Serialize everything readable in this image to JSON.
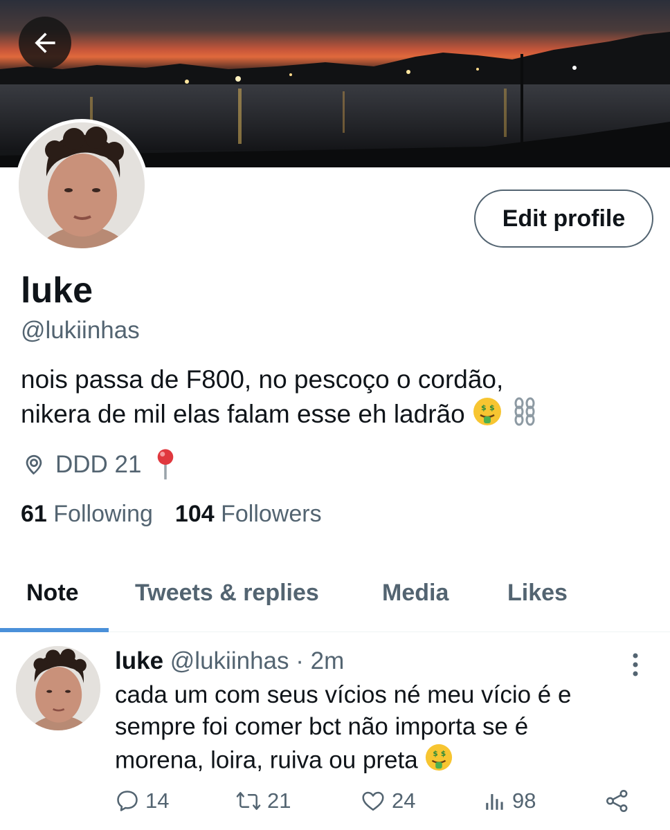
{
  "header": {
    "back_icon": "arrow-left-icon",
    "banner_description": "sunset-lake-photo"
  },
  "profile": {
    "name": "luke",
    "handle": "@lukiinhas",
    "bio_line1": "nois passa de F800, no pescoço o cordão,",
    "bio_line2": "nikera de mil elas falam esse eh ladrão",
    "location": "DDD 21",
    "edit_button": "Edit profile",
    "following_count": "61",
    "following_label": "Following",
    "followers_count": "104",
    "followers_label": "Followers"
  },
  "tabs": [
    {
      "label": "Note",
      "active": true
    },
    {
      "label": "Tweets & replies",
      "active": false
    },
    {
      "label": "Media",
      "active": false
    },
    {
      "label": "Likes",
      "active": false
    }
  ],
  "tweet": {
    "author_name": "luke",
    "author_handle": "@lukiinhas",
    "separator": "·",
    "time": "2m",
    "text_line1": "cada um com seus vícios né meu vício é e",
    "text_line2": "sempre foi comer bct não importa se é",
    "text_line3": "morena, loira, ruiva ou preta",
    "replies": "14",
    "retweets": "21",
    "likes": "24",
    "views": "98"
  },
  "colors": {
    "text_primary": "#0f1419",
    "text_secondary": "#536471",
    "accent": "#4a90d9"
  }
}
